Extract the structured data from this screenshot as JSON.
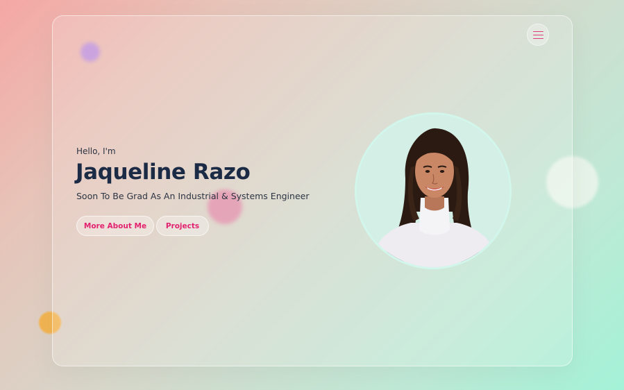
{
  "hero": {
    "greeting": "Hello, I'm",
    "name": "Jaqueline Razo",
    "tagline": "Soon To Be Grad As An Industrial & Systems Engineer"
  },
  "buttons": {
    "more_about_me": "More About Me",
    "projects": "Projects"
  },
  "nav": {
    "menu_icon": "hamburger-menu-icon"
  },
  "colors": {
    "accent": "#e3226f",
    "name_text": "#1c2b45",
    "background_start": "#f5a7a4",
    "background_end": "#a3f2d7"
  }
}
